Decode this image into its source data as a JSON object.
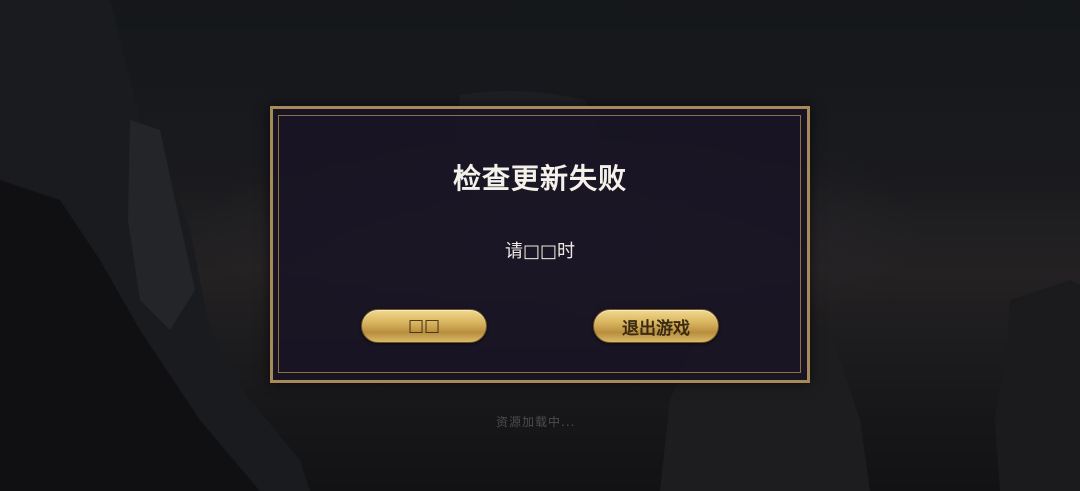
{
  "background": {
    "loading_text": "资源加载中..."
  },
  "dialog": {
    "title": "检查更新失败",
    "message": "请□□时",
    "left_button_label": "□□",
    "right_button_label": "退出游戏"
  },
  "colors": {
    "frame_gold": "#a8895a",
    "button_gold": "#d8b45e",
    "dialog_bg": "#18142a"
  }
}
